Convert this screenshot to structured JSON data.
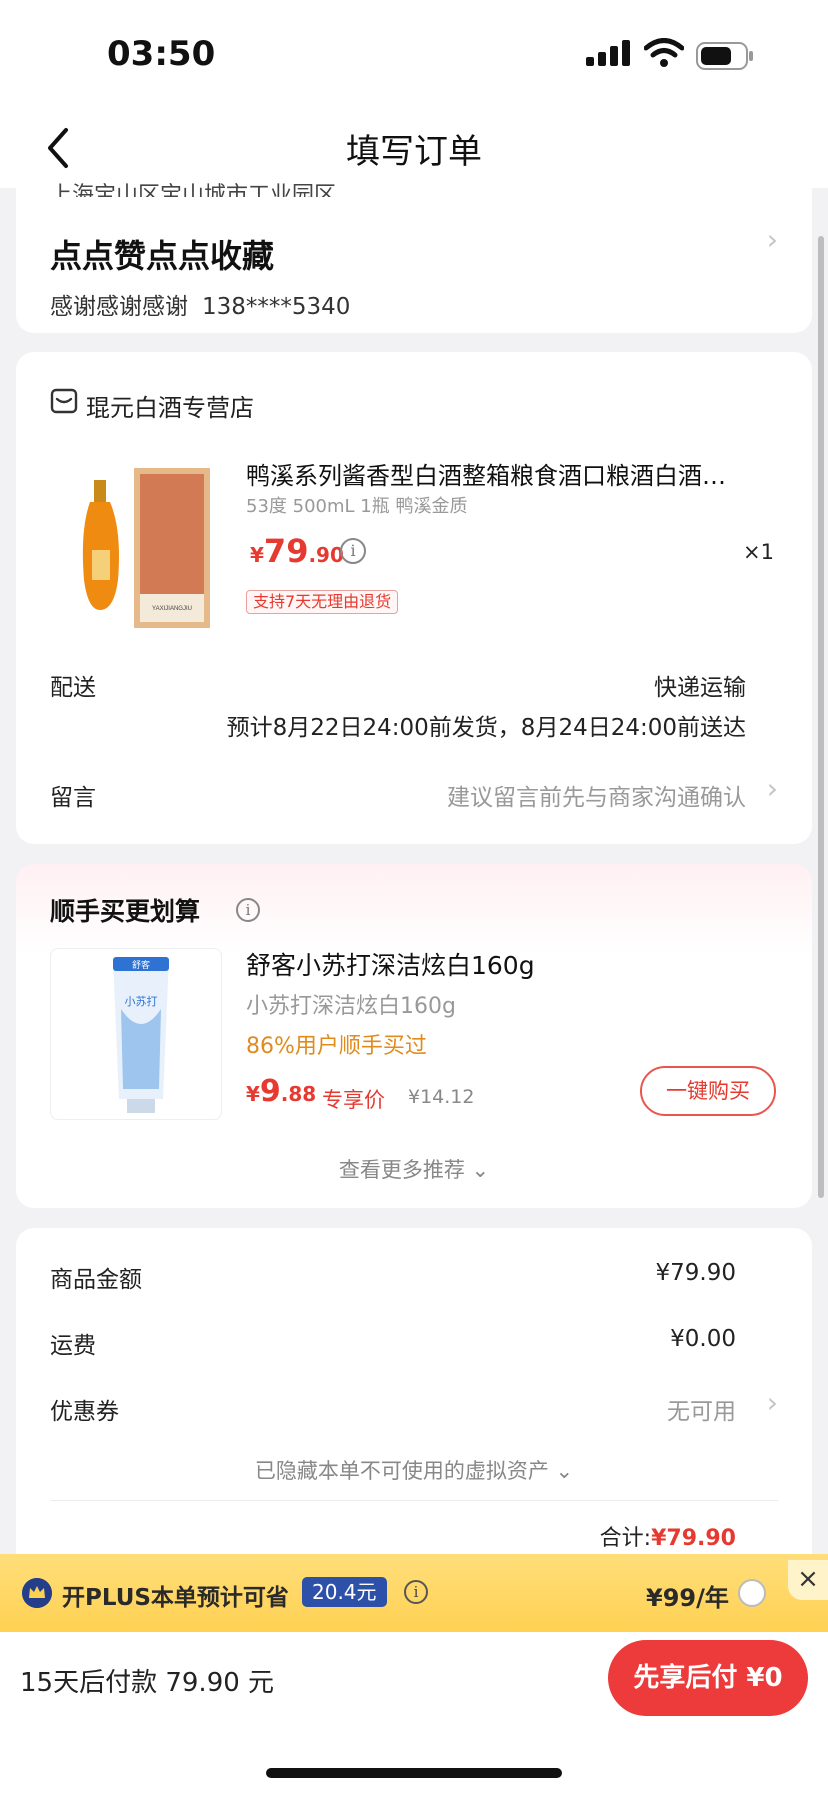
{
  "status_bar": {
    "time": "03:50"
  },
  "nav": {
    "title": "填写订单"
  },
  "address": {
    "line": "上海宝山区宝山城市工业园区",
    "name": "点点赞点点收藏",
    "recipient": "感谢感谢感谢",
    "phone": "138****5340"
  },
  "shop": {
    "name": "琨元白酒专营店",
    "product": {
      "title": "鸭溪系列酱香型白酒整箱粮食酒口粮酒白酒…",
      "spec": "53度 500mL 1瓶 鸭溪金质",
      "price_yen": "¥",
      "price_int": "79",
      "price_dec": ".90",
      "qty": "×1",
      "return_tag": "支持7天无理由退货",
      "box_text": "YAXIJIANGJIU"
    },
    "delivery_label": "配送",
    "delivery_method": "快递运输",
    "delivery_eta": "预计8月22日24:00前发货，8月24日24:00前送达",
    "note_label": "留言",
    "note_placeholder": "建议留言前先与商家沟通确认"
  },
  "recommend": {
    "title": "顺手买更划算",
    "item": {
      "name": "舒客小苏打深洁炫白160g",
      "spec": "小苏打深洁炫白160g",
      "social": "86%用户顺手买过",
      "price_yen": "¥",
      "price_int": "9",
      "price_dec": ".88",
      "exclusive": "专享价",
      "original": "¥14.12",
      "buy_label": "一键购买",
      "tube_brand": "舒客",
      "tube_text": "小苏打"
    },
    "more_label": "查看更多推荐"
  },
  "summary": {
    "goods_label": "商品金额",
    "goods_value": "¥79.90",
    "shipping_label": "运费",
    "shipping_value": "¥0.00",
    "coupon_label": "优惠券",
    "coupon_value": "无可用",
    "hidden_assets": "已隐藏本单不可使用的虚拟资产",
    "total_label": "合计:",
    "total_value": "¥79.90"
  },
  "plus": {
    "text": "开PLUS本单预计可省",
    "save": "20.4元",
    "price": "¥99/年"
  },
  "bottom": {
    "pay_text": "15天后付款 79.90 元",
    "pay_button": "先享后付 ¥0"
  },
  "colors": {
    "accent_red": "#e63a30",
    "pay_button": "#ec3b3a",
    "plus_yellow": "#ffd153",
    "plus_blue": "#2d50a8"
  },
  "icons": [
    "back-arrow-icon",
    "signal-icon",
    "wifi-icon",
    "battery-icon",
    "chevron-right-icon",
    "shop-icon",
    "info-icon",
    "chevron-down-icon",
    "crown-icon",
    "close-icon"
  ]
}
